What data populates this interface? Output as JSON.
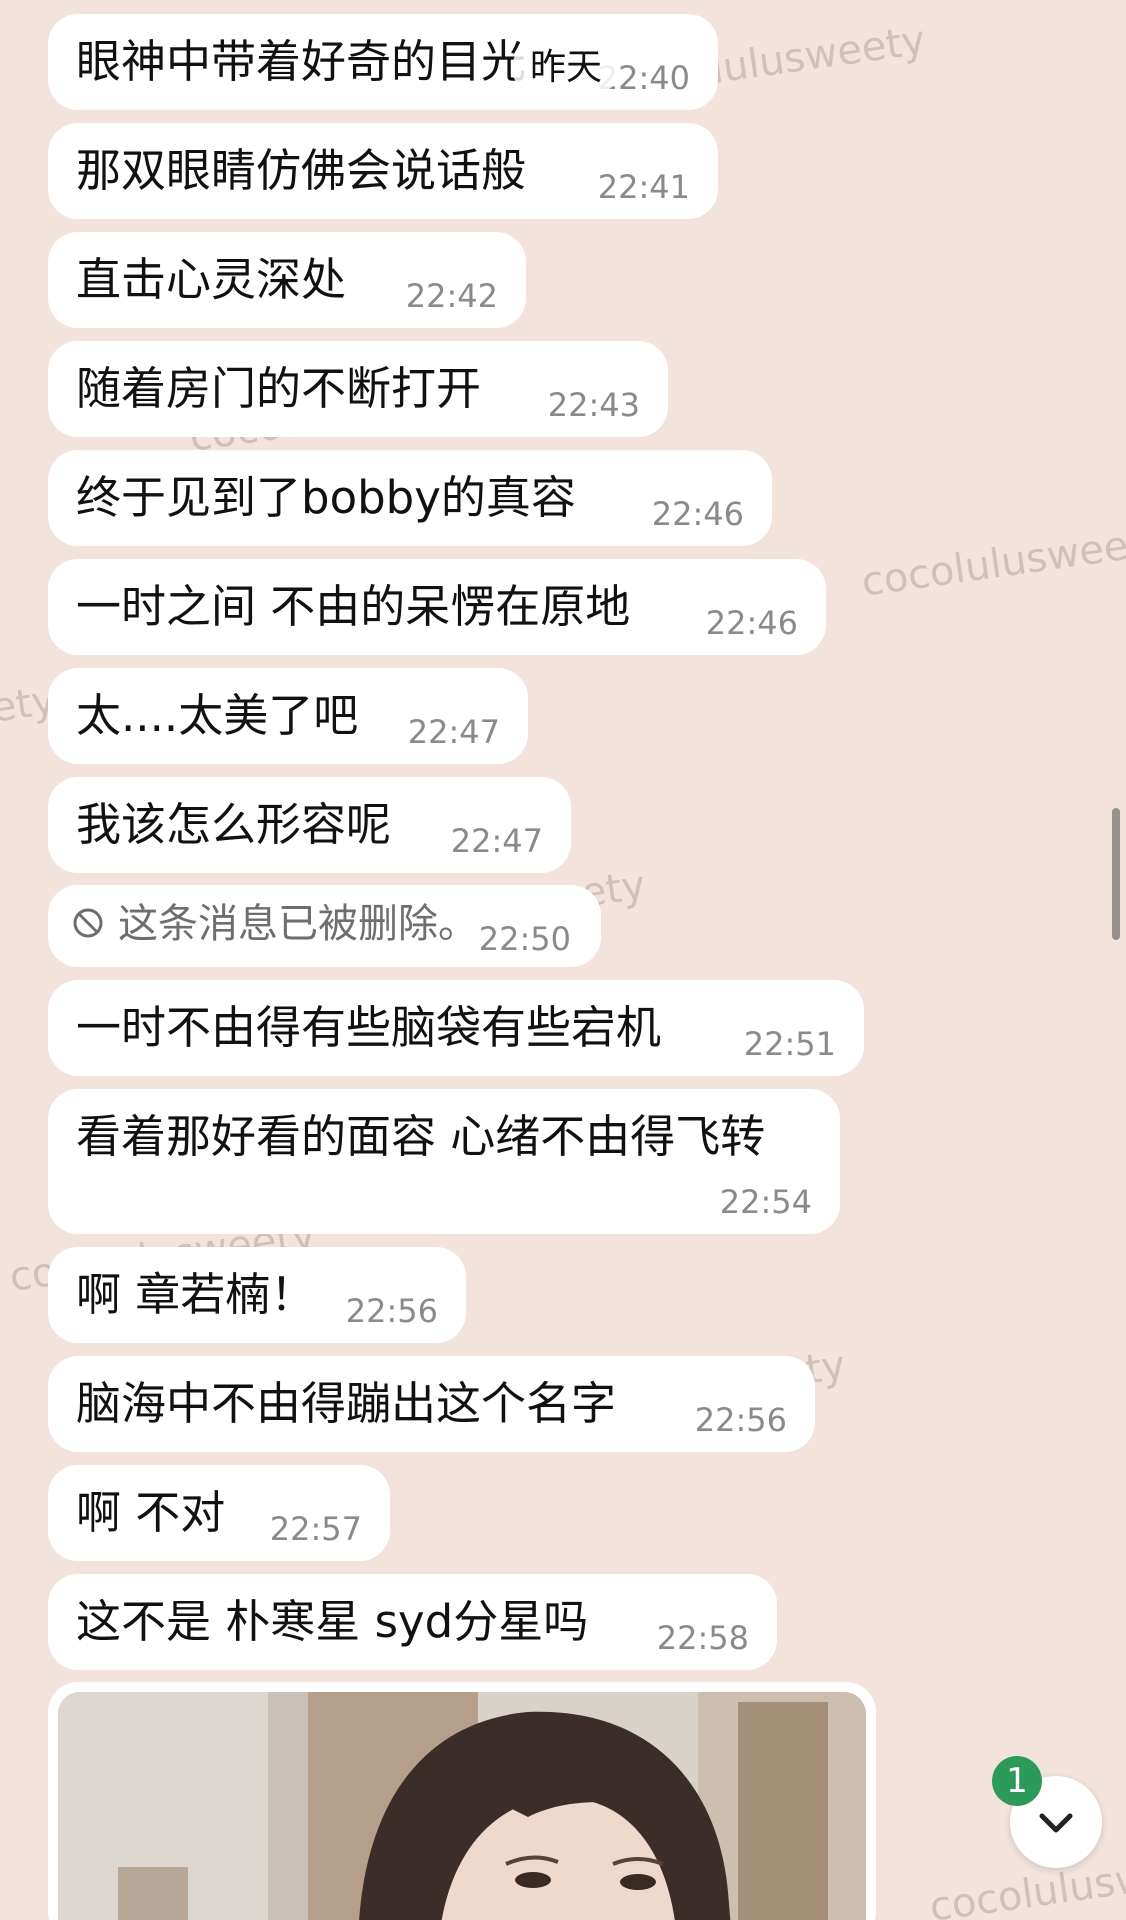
{
  "date_label": "昨天",
  "watermark_text": "cocolulusweety",
  "watermarks": [
    "cocolulusweety",
    "cocolulusweety",
    "cocolulusweety",
    "cocolulusweety",
    "cocolulusweety",
    "cocolulusweety",
    "cocolulusweety",
    "cocolulusweety"
  ],
  "messages": [
    {
      "text": "眼神中带着好奇的目光",
      "time": "22:40"
    },
    {
      "text": "那双眼睛仿佛会说话般",
      "time": "22:41"
    },
    {
      "text": "直击心灵深处",
      "time": "22:42"
    },
    {
      "text": "随着房门的不断打开",
      "time": "22:43"
    },
    {
      "text": "终于见到了bobby的真容",
      "time": "22:46"
    },
    {
      "text": "一时之间 不由的呆愣在原地",
      "time": "22:46"
    },
    {
      "text": "太....太美了吧",
      "time": "22:47"
    },
    {
      "text": "我该怎么形容呢",
      "time": "22:47"
    },
    {
      "text": "这条消息已被删除。",
      "time": "22:50",
      "deleted": true
    },
    {
      "text": "一时不由得有些脑袋有些宕机",
      "time": "22:51"
    },
    {
      "text": "看着那好看的面容 心绪不由得飞转",
      "time": "22:54"
    },
    {
      "text": "啊 章若楠！",
      "time": "22:56"
    },
    {
      "text": "脑海中不由得蹦出这个名字",
      "time": "22:56"
    },
    {
      "text": "啊 不对",
      "time": "22:57"
    },
    {
      "text": "这不是 朴寒星 syd分星吗",
      "time": "22:58"
    }
  ],
  "unread_count": "1",
  "colors": {
    "background": "#f2e4dc",
    "bubble": "#ffffff",
    "time_text": "#8a8a8a",
    "badge": "#2e9a5a"
  },
  "icons": [
    "deleted-icon",
    "chevron-down-icon"
  ]
}
